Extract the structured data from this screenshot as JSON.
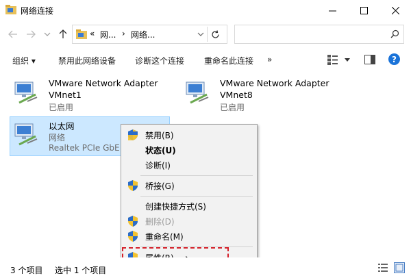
{
  "window": {
    "title": "网络连接",
    "minimize_icon": "minimize-icon",
    "maximize_icon": "maximize-icon",
    "close_icon": "close-icon"
  },
  "address": {
    "segment_prefix": "«",
    "segment1": "网...",
    "separator": "›",
    "segment2": "网络...",
    "search_placeholder": ""
  },
  "toolbar": {
    "organize": "组织 ▾",
    "disable_device": "禁用此网络设备",
    "diagnose": "诊断这个连接",
    "rename": "重命名此连接",
    "more": "»"
  },
  "items": [
    {
      "name": "VMware Network Adapter",
      "name2": "VMnet1",
      "status": "已启用"
    },
    {
      "name": "VMware Network Adapter",
      "name2": "VMnet8",
      "status": "已启用"
    },
    {
      "name": "以太网",
      "network": "网络",
      "device": "Realtek PCIe GbE F"
    }
  ],
  "context_menu": {
    "disable": "禁用(B)",
    "status": "状态(U)",
    "diagnose": "诊断(I)",
    "bridge": "桥接(G)",
    "shortcut": "创建快捷方式(S)",
    "delete": "删除(D)",
    "rename": "重命名(M)",
    "properties": "属性(R)"
  },
  "status_bar": {
    "count": "3 个项目",
    "selected": "选中 1 个项目"
  },
  "colors": {
    "selection_bg": "#cce8ff",
    "highlight_dash": "#d5202a",
    "help_blue": "#1a73d9"
  }
}
